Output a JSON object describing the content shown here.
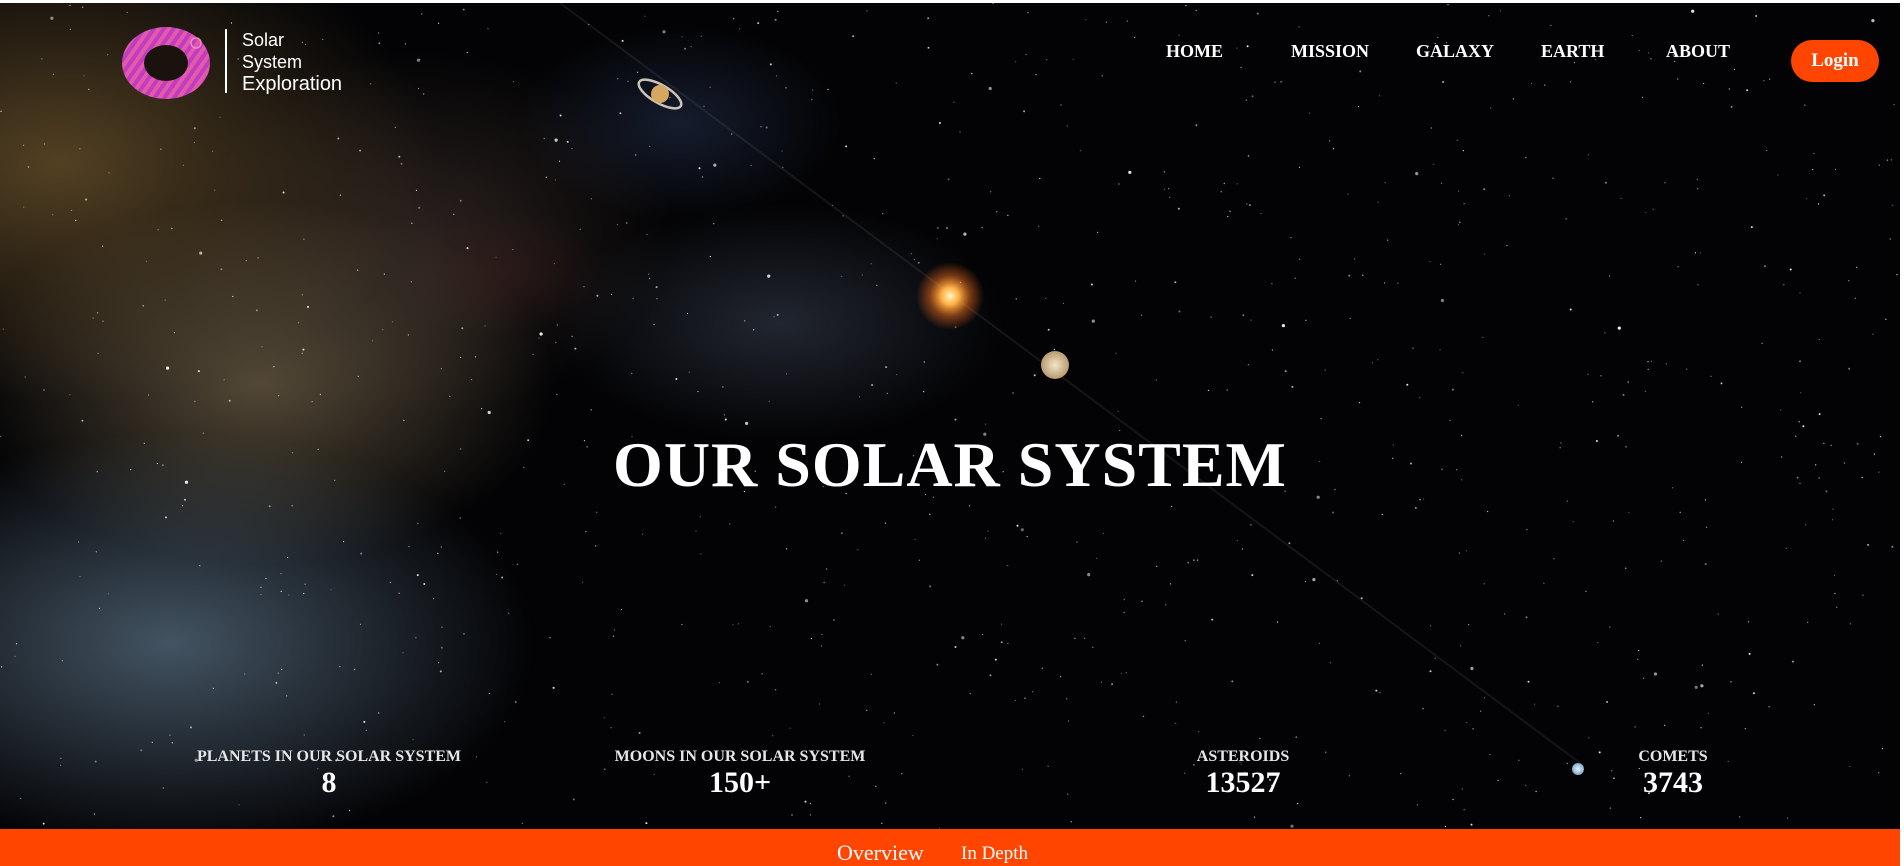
{
  "brand": {
    "line1": "Solar",
    "line2": "System",
    "line3": "Exploration",
    "ring_colors": [
      "#b23cc8",
      "#e05ab0"
    ]
  },
  "nav": {
    "items": [
      {
        "label": "HOME"
      },
      {
        "label": "MISSION"
      },
      {
        "label": "GALAXY"
      },
      {
        "label": "EARTH"
      },
      {
        "label": "ABOUT"
      }
    ],
    "login_label": "Login",
    "accent_color": "#ff4500"
  },
  "hero": {
    "title": "OUR SOLAR SYSTEM"
  },
  "stats": [
    {
      "label": "PLANETS IN OUR SOLAR SYSTEM",
      "value": "8"
    },
    {
      "label": "MOONS IN OUR SOLAR SYSTEM",
      "value": "150+"
    },
    {
      "label": "ASTEROIDS",
      "value": "13527"
    },
    {
      "label": "COMETS",
      "value": "3743"
    }
  ],
  "tabs": [
    {
      "label": "Overview"
    },
    {
      "label": "In Depth"
    }
  ]
}
